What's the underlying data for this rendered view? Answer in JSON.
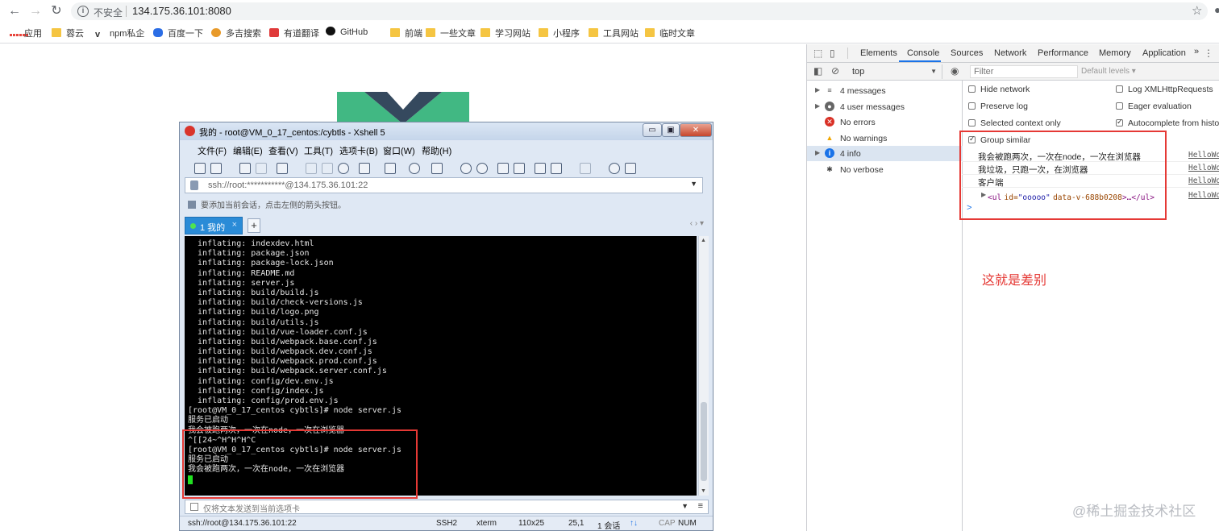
{
  "browser": {
    "security_label": "不安全",
    "url": "134.175.36.101:8080",
    "bookmarks": [
      {
        "label": "应用",
        "kind": "apps"
      },
      {
        "label": "蓉云",
        "kind": "folder"
      },
      {
        "label": "npm私企",
        "kind": "v"
      },
      {
        "label": "百度一下",
        "kind": "baidu"
      },
      {
        "label": "多吉搜索",
        "kind": "dog"
      },
      {
        "label": "有道翻译",
        "kind": "youdao"
      },
      {
        "label": "GitHub",
        "kind": "github"
      },
      {
        "label": "前端",
        "kind": "folder"
      },
      {
        "label": "一些文章",
        "kind": "folder"
      },
      {
        "label": "学习网站",
        "kind": "folder"
      },
      {
        "label": "小程序",
        "kind": "folder"
      },
      {
        "label": "工具网站",
        "kind": "folder"
      },
      {
        "label": "临时文章",
        "kind": "folder"
      }
    ]
  },
  "xshell": {
    "title": "我的 - root@VM_0_17_centos:/cybtls - Xshell 5",
    "win_buttons": {
      "min": "▭",
      "restore": "▣",
      "close": "✕"
    },
    "menu": [
      "文件(F)",
      "编辑(E)",
      "查看(V)",
      "工具(T)",
      "选项卡(B)",
      "窗口(W)",
      "帮助(H)"
    ],
    "address": "ssh://root:***********@134.175.36.101:22",
    "hint": "要添加当前会话，点击左侧的箭头按钮。",
    "tab": {
      "label": "1 我的",
      "close": "×",
      "add": "+"
    },
    "terminal_lines": [
      "  inflating: indexdev.html",
      "  inflating: package.json",
      "  inflating: package-lock.json",
      "  inflating: README.md",
      "  inflating: server.js",
      "  inflating: build/build.js",
      "  inflating: build/check-versions.js",
      "  inflating: build/logo.png",
      "  inflating: build/utils.js",
      "  inflating: build/vue-loader.conf.js",
      "  inflating: build/webpack.base.conf.js",
      "  inflating: build/webpack.dev.conf.js",
      "  inflating: build/webpack.prod.conf.js",
      "  inflating: build/webpack.server.conf.js",
      "  inflating: config/dev.env.js",
      "  inflating: config/index.js",
      "  inflating: config/prod.env.js",
      "[root@VM_0_17_centos cybtls]# node server.js",
      "服务已启动",
      "我会被跑两次，一次在node，一次在浏览器",
      "^[[24~^H^H^H^C",
      "[root@VM_0_17_centos cybtls]# node server.js",
      "服务已启动",
      "我会被跑两次，一次在node，一次在浏览器"
    ],
    "send_placeholder": "仅将文本发送到当前选项卡",
    "status": {
      "connection": "ssh://root@134.175.36.101:22",
      "protocol": "SSH2",
      "term": "xterm",
      "size": "110x25",
      "pos": "25,1",
      "sessions": "1 会话",
      "cap": "CAP",
      "num": "NUM"
    }
  },
  "devtools": {
    "tabs": [
      "Elements",
      "Console",
      "Sources",
      "Network",
      "Performance",
      "Memory",
      "Application"
    ],
    "more": "»",
    "context": "top",
    "filter_placeholder": "Filter",
    "levels": "Default levels ▾",
    "sidebar": [
      {
        "label": "4 messages",
        "icon": "list"
      },
      {
        "label": "4 user messages",
        "icon": "user"
      },
      {
        "label": "No errors",
        "icon": "error"
      },
      {
        "label": "No warnings",
        "icon": "warning"
      },
      {
        "label": "4 info",
        "icon": "info"
      },
      {
        "label": "No verbose",
        "icon": "verbose"
      }
    ],
    "settings": {
      "hide_network": "Hide network",
      "preserve_log": "Preserve log",
      "selected_context": "Selected context only",
      "group_similar": "Group similar",
      "log_xhr": "Log XMLHttpRequests",
      "eager_eval": "Eager evaluation",
      "autocomplete": "Autocomplete from history"
    },
    "messages": [
      {
        "text": "我会被跑两次，一次在node，一次在浏览器",
        "source": "HelloWorld.v"
      },
      {
        "text": "我垃圾，只跑一次，在浏览器",
        "source": "HelloWorld.v"
      },
      {
        "text": "客户端",
        "source": "HelloWorld.v"
      }
    ],
    "element_log": {
      "open": "<ul",
      "attr1": "id=",
      "val1": "\"ooooo\"",
      "attr2": "data-v-688b0208",
      "close": ">…</ul>",
      "source": "HelloWorld.v"
    },
    "prompt": ">"
  },
  "annotation": "这就是差别",
  "watermark": "@稀土掘金技术社区"
}
